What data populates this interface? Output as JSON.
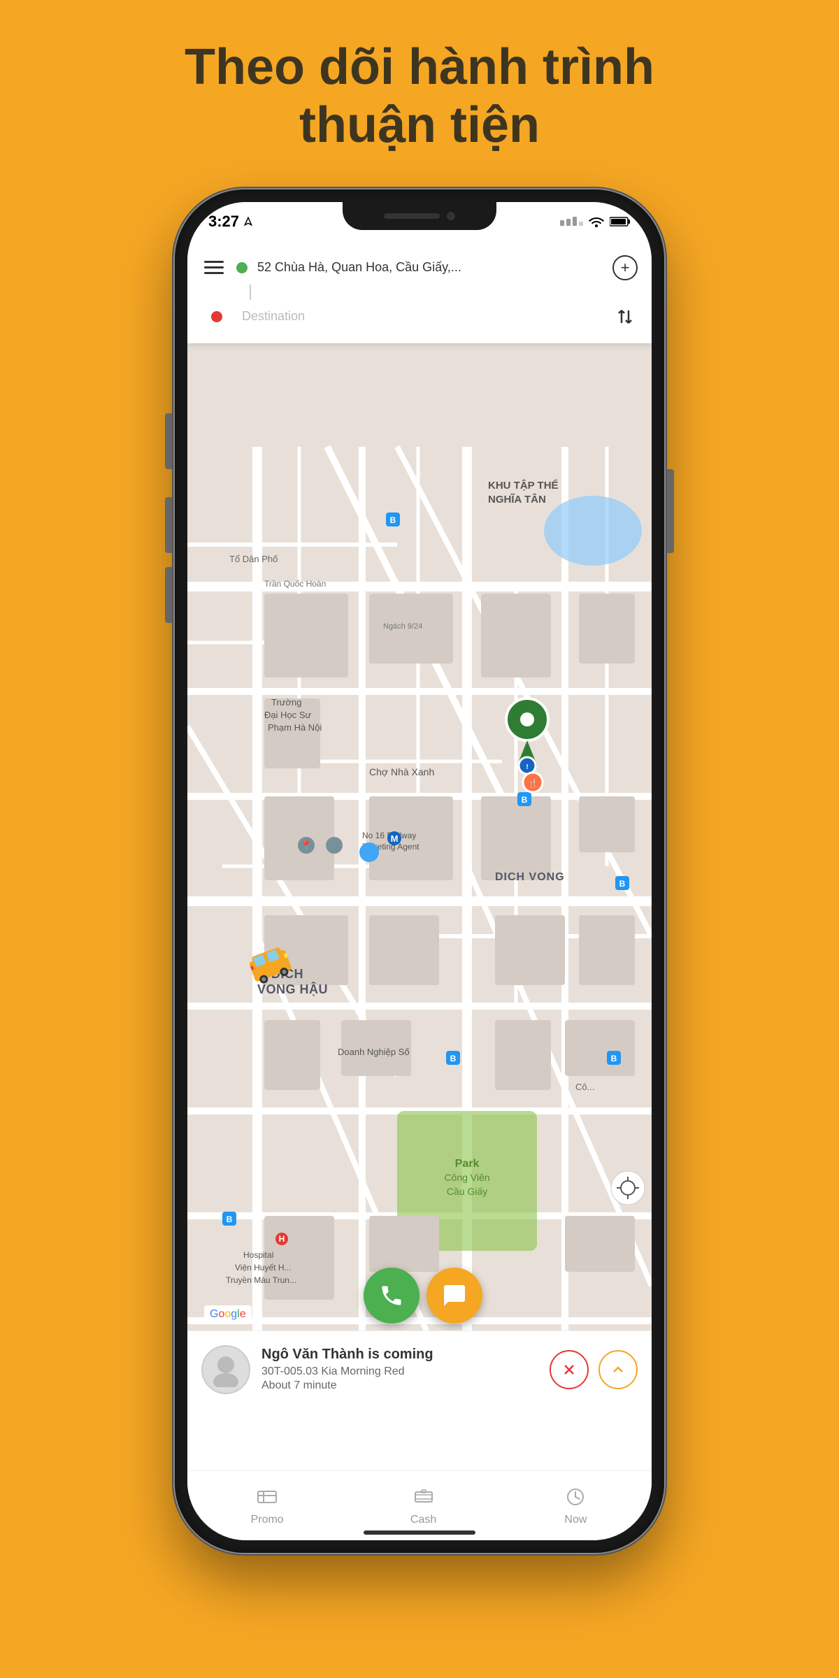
{
  "page": {
    "background_color": "#F5A623",
    "header": {
      "line1": "Theo dõi hành trình",
      "line2": "thuận tiện"
    }
  },
  "phone": {
    "status_bar": {
      "time": "3:27",
      "signal": "...",
      "wifi": "wifi",
      "battery": "battery"
    },
    "search": {
      "address": "52 Chùa Hà, Quan Hoa, Cầu Giấy,...",
      "destination_placeholder": "Destination"
    },
    "map": {
      "labels": [
        "Tổ Dân Phố",
        "KHU TẬP THỂ NGHĨA TÂN",
        "Trần Quốc Hoàn",
        "Ngách 9/24",
        "Trường Đại Học Sư Phạm Hà Nội",
        "Chợ Nhà Xanh",
        "No 16 Railway Ticketing Agent",
        "DICH VONG",
        "DICH VONG HẬU",
        "Doanh Nghiệp Số",
        "Park Công Viên Cầu Giấy",
        "Hospital Viện Huyết H... Truyền Máu Trun...",
        "Cô..."
      ]
    },
    "driver": {
      "name": "Ngô Văn Thành is coming",
      "vehicle": "30T-005.03 Kia Morning Red",
      "eta": "About 7 minute"
    },
    "tabs": [
      {
        "icon": "promo-icon",
        "label": "Promo"
      },
      {
        "icon": "cash-icon",
        "label": "Cash"
      },
      {
        "icon": "clock-icon",
        "label": "Now"
      }
    ]
  }
}
